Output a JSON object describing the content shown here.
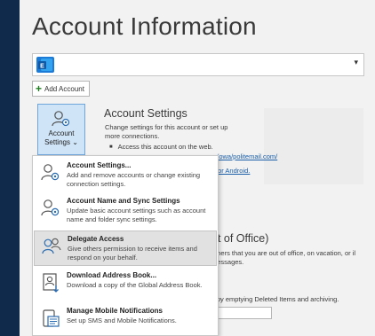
{
  "page": {
    "title": "Account Information"
  },
  "account_selector": {
    "icon": "exchange-icon",
    "arrow": "▾"
  },
  "add_account": {
    "label": "Add Account",
    "icon": "plus-icon"
  },
  "account_settings_button": {
    "label_line1": "Account",
    "label_line2": "Settings",
    "chevron": "⌄"
  },
  "account_settings_section": {
    "heading": "Account Settings",
    "description": "Change settings for this account or set up more connections.",
    "bullet": "Access this account on the web."
  },
  "background": {
    "link1": "m/owa/politemail.com/",
    "link2": "S or Android.",
    "oof_heading": "ut of Office)",
    "oof_desc": "others that you are out of office, on vacation, or il messages.",
    "cleanup_desc": "x by emptying Deleted Items and archiving."
  },
  "menu": {
    "items": [
      {
        "title": "Account Settings...",
        "description": "Add and remove accounts or change existing connection settings.",
        "icon": "account-settings-icon",
        "highlighted": false
      },
      {
        "title": "Account Name and Sync Settings",
        "description": "Update basic account settings such as account name and folder sync settings.",
        "icon": "account-sync-icon",
        "highlighted": false
      },
      {
        "title": "Delegate Access",
        "description": "Give others permission to receive items and respond on your behalf.",
        "icon": "delegate-access-icon",
        "highlighted": true
      },
      {
        "title": "Download Address Book...",
        "description": "Download a copy of the Global Address Book.",
        "icon": "address-book-icon",
        "highlighted": false
      },
      {
        "title": "Manage Mobile Notifications",
        "description": "Set up SMS and Mobile Notifications.",
        "icon": "mobile-notifications-icon",
        "highlighted": false
      }
    ]
  },
  "colors": {
    "link": "#1a5ea8",
    "accent_blue": "#2b6cb0",
    "highlight": "#e1e1e1",
    "frame_bg": "#0f2a4a"
  }
}
